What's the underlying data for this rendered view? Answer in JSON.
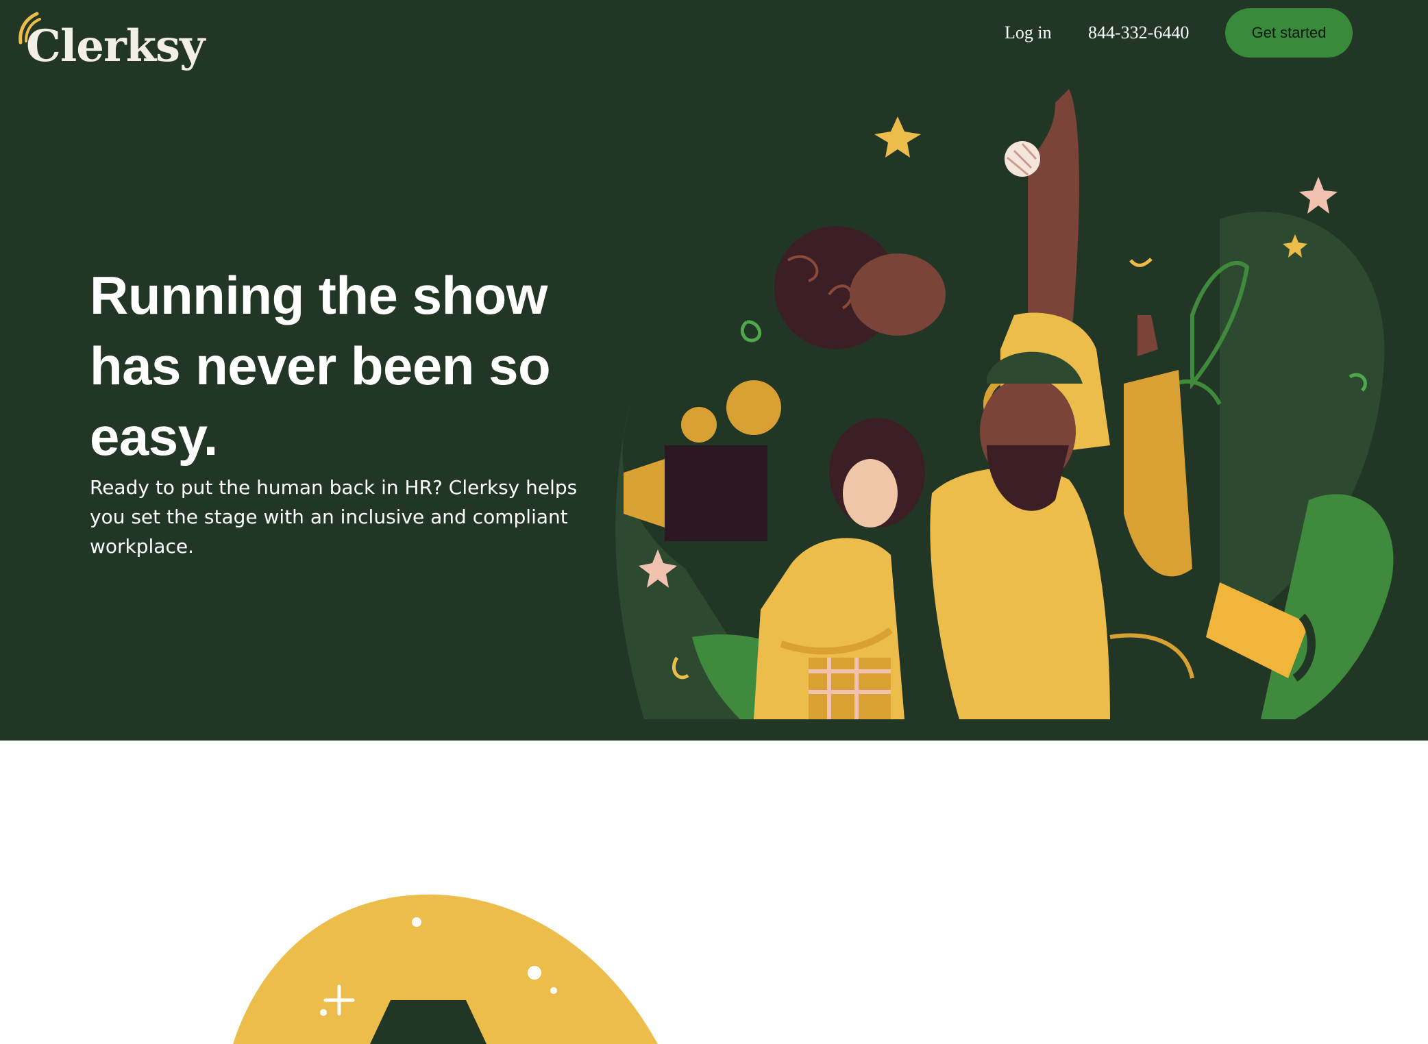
{
  "brand": {
    "name": "Clerksy"
  },
  "nav": {
    "login_label": "Log in",
    "phone": "844-332-6440",
    "cta_label": "Get started"
  },
  "hero": {
    "headline": "Running the show has never been so easy.",
    "subcopy": "Ready to put the human back in HR? Clerksy helps you set the stage with an inclusive and compliant workplace."
  },
  "colors": {
    "hero_bg": "#223626",
    "cta_green": "#3a8a3c",
    "accent_yellow": "#ecbd4a",
    "page_bg": "#ffffff"
  },
  "icons": {
    "logo_swoosh": "swoosh-icon",
    "hero_art": "people-celebrating-illustration",
    "section_art": "yellow-arch-illustration"
  }
}
